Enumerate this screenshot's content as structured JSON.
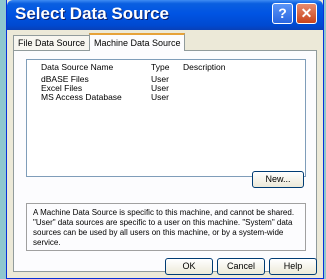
{
  "window": {
    "title": "Select Data Source"
  },
  "titlebar": {
    "help_glyph": "?",
    "close_glyph": "✕"
  },
  "tabs": [
    {
      "label": "File Data Source"
    },
    {
      "label": "Machine Data Source"
    }
  ],
  "table": {
    "headers": [
      "Data Source Name",
      "Type",
      "Description"
    ],
    "rows": [
      {
        "name": "dBASE Files",
        "type": "User",
        "description": ""
      },
      {
        "name": "Excel Files",
        "type": "User",
        "description": ""
      },
      {
        "name": "MS Access Database",
        "type": "User",
        "description": ""
      }
    ]
  },
  "buttons": {
    "new": "New...",
    "ok": "OK",
    "cancel": "Cancel",
    "help": "Help"
  },
  "description_text": "A Machine Data Source is specific to this machine, and cannot be shared. \"User\" data sources are specific to a user on this machine.  \"System\" data sources can be used by all users on this machine, or by a system-wide service.",
  "icons": {
    "help": "help-icon",
    "close": "close-icon"
  }
}
